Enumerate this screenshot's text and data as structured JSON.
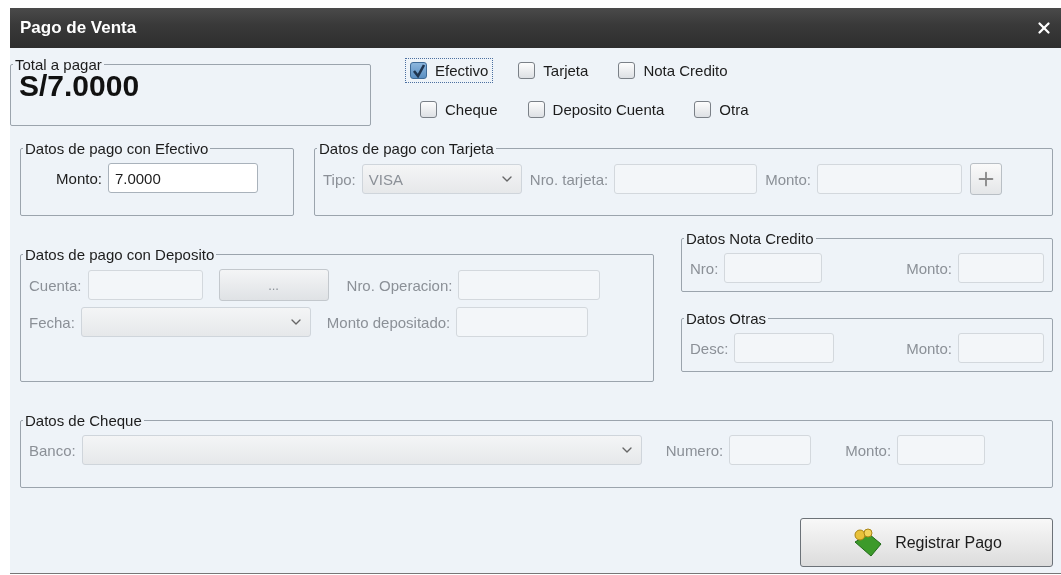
{
  "window": {
    "title": "Pago de Venta"
  },
  "total": {
    "label": "Total a pagar",
    "value": "S/7.0000"
  },
  "payment_methods": [
    {
      "label": "Efectivo",
      "checked": true,
      "focused": true
    },
    {
      "label": "Tarjeta",
      "checked": false,
      "focused": false
    },
    {
      "label": "Nota Credito",
      "checked": false,
      "focused": false
    },
    {
      "label": "Cheque",
      "checked": false,
      "focused": false
    },
    {
      "label": "Deposito Cuenta",
      "checked": false,
      "focused": false
    },
    {
      "label": "Otra",
      "checked": false,
      "focused": false
    }
  ],
  "sections": {
    "efectivo": {
      "title": "Datos de pago con Efectivo",
      "disabled": false,
      "rows": [
        [
          {
            "kind": "input",
            "label": "Monto:",
            "value": "7.0000"
          }
        ]
      ]
    },
    "tarjeta": {
      "title": "Datos de pago con Tarjeta",
      "disabled": true,
      "rows": [
        [
          {
            "kind": "select",
            "label": "Tipo:",
            "value": "VISA"
          },
          {
            "kind": "input",
            "label": "Nro. tarjeta:"
          },
          {
            "kind": "input",
            "label": "Monto:"
          },
          {
            "kind": "add"
          }
        ]
      ]
    },
    "deposito": {
      "title": "Datos de pago con Deposito",
      "disabled": true,
      "rows": [
        [
          {
            "kind": "input",
            "label": "Cuenta:"
          },
          {
            "kind": "button",
            "label": "..."
          },
          {
            "kind": "input",
            "label": "Nro. Operacion:"
          }
        ],
        [
          {
            "kind": "select",
            "label": "Fecha:"
          },
          "",
          {
            "kind": "input",
            "label": "Monto depositado:"
          }
        ]
      ]
    },
    "nota_credito": {
      "title": "Datos Nota Credito",
      "disabled": true,
      "rows": [
        [
          {
            "kind": "input",
            "label": "Nro:"
          },
          {
            "kind": "input",
            "label": "Monto:"
          }
        ]
      ]
    },
    "otras": {
      "title": "Datos Otras",
      "disabled": true,
      "rows": [
        [
          {
            "kind": "input",
            "label": "Desc:"
          },
          {
            "kind": "input",
            "label": "Monto:"
          }
        ]
      ]
    },
    "cheque": {
      "title": "Datos de Cheque",
      "disabled": true,
      "rows": [
        [
          {
            "kind": "select",
            "label": "Banco:"
          },
          {
            "kind": "input",
            "label": "Numero:"
          },
          {
            "kind": "input",
            "label": "Monto:"
          }
        ]
      ]
    }
  },
  "submit": {
    "label": "Registrar Pago"
  }
}
